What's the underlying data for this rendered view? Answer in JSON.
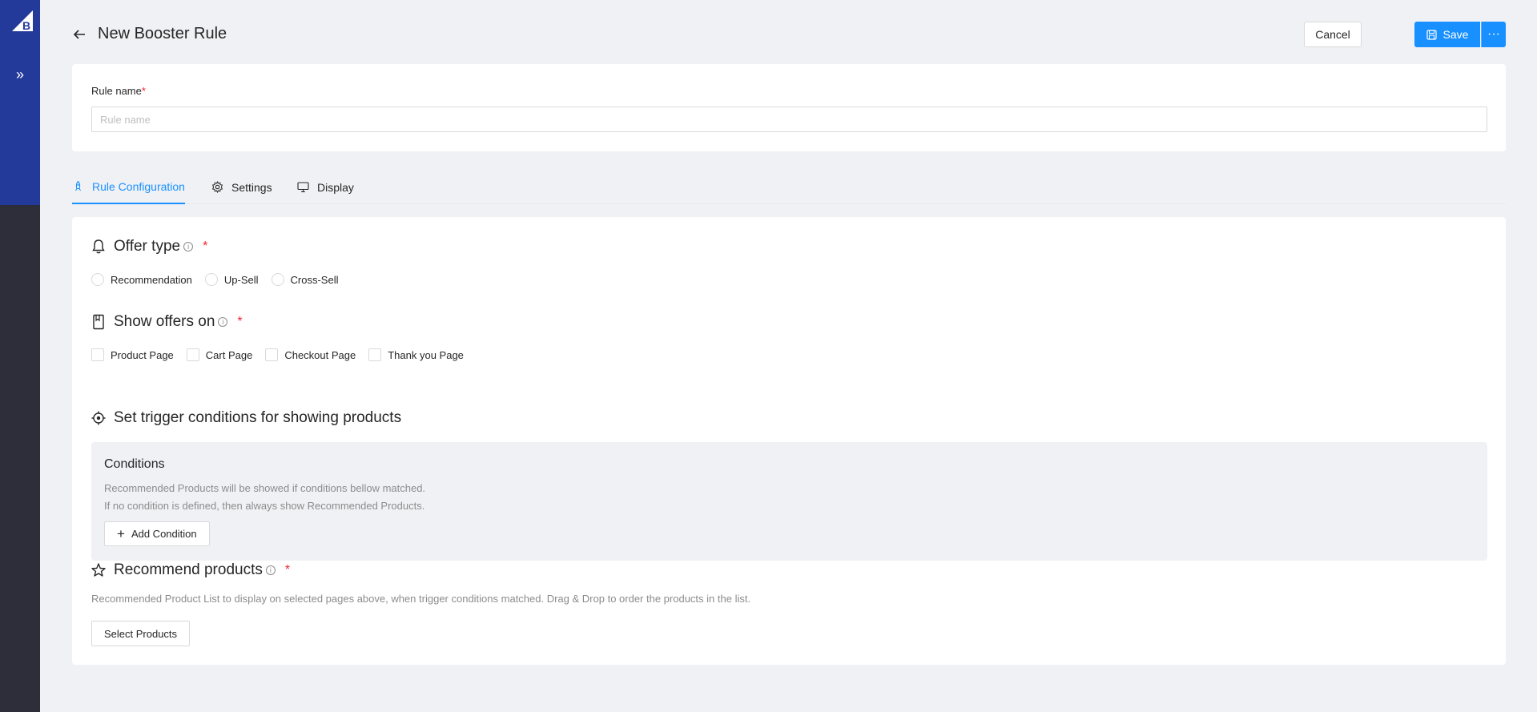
{
  "header": {
    "title": "New Booster Rule",
    "cancel_label": "Cancel",
    "save_label": "Save",
    "more_label": "···"
  },
  "sidebar": {
    "logo_icon": "bigcommerce-logo",
    "expand_icon": "double-chevron-right-icon"
  },
  "rule_name": {
    "label": "Rule name",
    "required_mark": "*",
    "placeholder": "Rule name",
    "value": ""
  },
  "tabs": [
    {
      "label": "Rule Configuration",
      "icon": "rocket-icon",
      "active": true
    },
    {
      "label": "Settings",
      "icon": "gear-icon",
      "active": false
    },
    {
      "label": "Display",
      "icon": "monitor-icon",
      "active": false
    }
  ],
  "offer_type": {
    "title": "Offer type",
    "info": "i",
    "required_mark": "*",
    "options": [
      "Recommendation",
      "Up-Sell",
      "Cross-Sell"
    ]
  },
  "show_offers": {
    "title": "Show offers on",
    "info": "i",
    "required_mark": "*",
    "options": [
      "Product Page",
      "Cart Page",
      "Checkout Page",
      "Thank you Page"
    ]
  },
  "trigger": {
    "title": "Set trigger conditions for showing products"
  },
  "conditions": {
    "title": "Conditions",
    "desc1": "Recommended Products will be showed if conditions bellow matched.",
    "desc2": "If no condition is defined, then always show Recommended Products.",
    "add_label": "Add Condition"
  },
  "recommend": {
    "title": "Recommend products",
    "info": "i",
    "required_mark": "*",
    "desc": "Recommended Product List to display on selected pages above, when trigger conditions matched. Drag & Drop to order the products in the list.",
    "select_label": "Select Products"
  },
  "colors": {
    "sidebar_top": "#243a9b",
    "sidebar": "#2e2d3a",
    "primary": "#1890ff",
    "required": "#f5222d"
  }
}
